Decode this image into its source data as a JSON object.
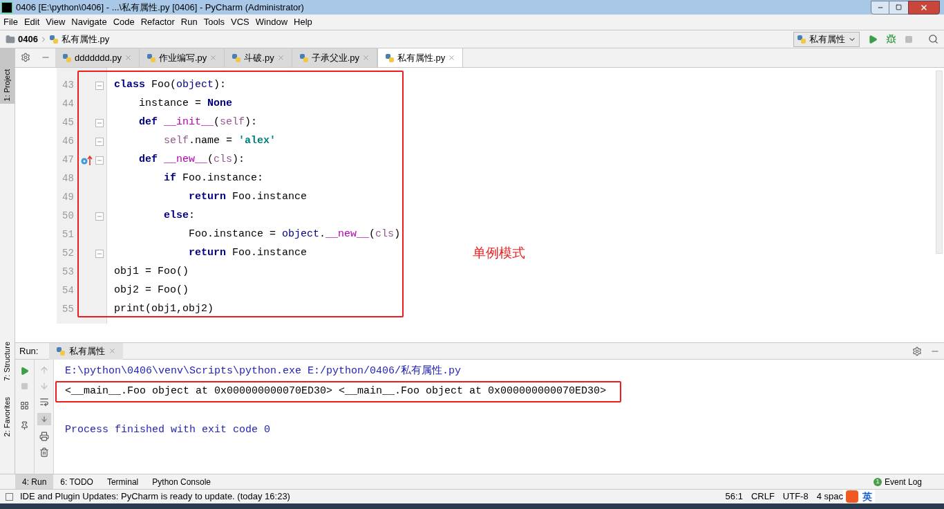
{
  "window": {
    "title": "0406 [E:\\python\\0406] - ...\\私有属性.py [0406] - PyCharm (Administrator)"
  },
  "menu": [
    "File",
    "Edit",
    "View",
    "Navigate",
    "Code",
    "Refactor",
    "Run",
    "Tools",
    "VCS",
    "Window",
    "Help"
  ],
  "breadcrumb": {
    "project": "0406",
    "file": "私有属性.py"
  },
  "run_config": {
    "label": "私有属性"
  },
  "side_tabs_left": [
    {
      "label": "1: Project",
      "selected": true
    },
    {
      "label": "7: Structure",
      "selected": false
    },
    {
      "label": "2: Favorites",
      "selected": false
    }
  ],
  "tabs": [
    {
      "label": "ddddddd.py",
      "selected": false
    },
    {
      "label": "作业编写.py",
      "selected": false
    },
    {
      "label": "斗破.py",
      "selected": false
    },
    {
      "label": "子承父业.py",
      "selected": false
    },
    {
      "label": "私有属性.py",
      "selected": true
    }
  ],
  "editor": {
    "lines": [
      {
        "number": "43",
        "fold": true,
        "marker": false,
        "tokens": [
          {
            "kind": "kw",
            "text": "class"
          },
          {
            "kind": "plain",
            "text": " Foo("
          },
          {
            "kind": "builtin",
            "text": "object"
          },
          {
            "kind": "plain",
            "text": "):"
          }
        ]
      },
      {
        "number": "44",
        "fold": false,
        "marker": false,
        "tokens": [
          {
            "kind": "plain",
            "text": "    instance = "
          },
          {
            "kind": "kw",
            "text": "None"
          }
        ]
      },
      {
        "number": "45",
        "fold": true,
        "marker": false,
        "tokens": [
          {
            "kind": "kw",
            "text": "    def "
          },
          {
            "kind": "magic",
            "text": "__init__"
          },
          {
            "kind": "plain",
            "text": "("
          },
          {
            "kind": "self",
            "text": "self"
          },
          {
            "kind": "plain",
            "text": "):"
          }
        ]
      },
      {
        "number": "46",
        "fold": true,
        "marker": false,
        "tokens": [
          {
            "kind": "self",
            "text": "        self"
          },
          {
            "kind": "plain",
            "text": ".name = "
          },
          {
            "kind": "str",
            "text": "'alex'"
          }
        ]
      },
      {
        "number": "47",
        "fold": true,
        "marker": true,
        "tokens": [
          {
            "kind": "kw",
            "text": "    def "
          },
          {
            "kind": "magic",
            "text": "__new__"
          },
          {
            "kind": "plain",
            "text": "("
          },
          {
            "kind": "self",
            "text": "cls"
          },
          {
            "kind": "plain",
            "text": "):"
          }
        ]
      },
      {
        "number": "48",
        "fold": false,
        "marker": false,
        "tokens": [
          {
            "kind": "kw",
            "text": "        if"
          },
          {
            "kind": "plain",
            "text": " Foo.instance:"
          }
        ]
      },
      {
        "number": "49",
        "fold": false,
        "marker": false,
        "tokens": [
          {
            "kind": "kw",
            "text": "            return"
          },
          {
            "kind": "plain",
            "text": " Foo.instance"
          }
        ]
      },
      {
        "number": "50",
        "fold": true,
        "marker": false,
        "tokens": [
          {
            "kind": "kw",
            "text": "        else"
          },
          {
            "kind": "plain",
            "text": ":"
          }
        ]
      },
      {
        "number": "51",
        "fold": false,
        "marker": false,
        "tokens": [
          {
            "kind": "plain",
            "text": "            Foo.instance = "
          },
          {
            "kind": "builtin",
            "text": "object"
          },
          {
            "kind": "plain",
            "text": "."
          },
          {
            "kind": "magic",
            "text": "__new__"
          },
          {
            "kind": "plain",
            "text": "("
          },
          {
            "kind": "self",
            "text": "cls"
          },
          {
            "kind": "plain",
            "text": ")"
          }
        ]
      },
      {
        "number": "52",
        "fold": true,
        "marker": false,
        "tokens": [
          {
            "kind": "kw",
            "text": "            return"
          },
          {
            "kind": "plain",
            "text": " Foo.instance"
          }
        ]
      },
      {
        "number": "53",
        "fold": false,
        "marker": false,
        "tokens": [
          {
            "kind": "plain",
            "text": "obj1 = Foo()"
          }
        ]
      },
      {
        "number": "54",
        "fold": false,
        "marker": false,
        "tokens": [
          {
            "kind": "plain",
            "text": "obj2 = Foo()"
          }
        ]
      },
      {
        "number": "55",
        "fold": false,
        "marker": false,
        "tokens": [
          {
            "kind": "plain",
            "text": "print(obj1,obj2)"
          }
        ]
      }
    ],
    "annotation": "单例模式"
  },
  "run_panel": {
    "label": "Run:",
    "tab": "私有属性",
    "output": [
      {
        "kind": "command",
        "text": "E:\\python\\0406\\venv\\Scripts\\python.exe E:/python/0406/私有属性.py"
      },
      {
        "kind": "stdout",
        "text": "<__main__.Foo object at 0x000000000070ED30> <__main__.Foo object at 0x000000000070ED30>"
      },
      {
        "kind": "system",
        "text": "Process finished with exit code 0"
      }
    ]
  },
  "tool_tabs": [
    {
      "label": "4: Run",
      "selected": true
    },
    {
      "label": "6: TODO",
      "selected": false
    },
    {
      "label": "Terminal",
      "selected": false
    },
    {
      "label": "Python Console",
      "selected": false
    }
  ],
  "event_log": {
    "count": "1",
    "label": "Event Log"
  },
  "status_bar": {
    "message": "IDE and Plugin Updates: PyCharm is ready to update. (today 16:23)",
    "position": "56:1",
    "line_sep": "CRLF",
    "encoding": "UTF-8",
    "indent": "4 spac",
    "ime": "英"
  }
}
